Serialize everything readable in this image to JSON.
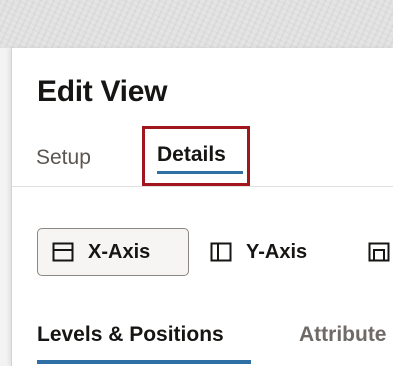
{
  "header": {
    "title": "Edit View"
  },
  "tabs": [
    {
      "label": "Setup",
      "selected": false
    },
    {
      "label": "Details",
      "selected": true
    }
  ],
  "axis_buttons": [
    {
      "label": "X-Axis",
      "icon": "x-axis-layout-icon",
      "selected": true
    },
    {
      "label": "Y-Axis",
      "icon": "y-axis-layout-icon",
      "selected": false
    },
    {
      "label": "",
      "icon": "z-axis-layout-icon",
      "selected": false
    }
  ],
  "subtabs": [
    {
      "label": "Levels & Positions",
      "selected": true
    },
    {
      "label": "Attribute",
      "selected": false
    }
  ],
  "colors": {
    "highlight_border": "#a1161c",
    "selected_tab_underline": "#2e6fa5",
    "text_primary": "#161513",
    "text_secondary": "#5b5652"
  }
}
